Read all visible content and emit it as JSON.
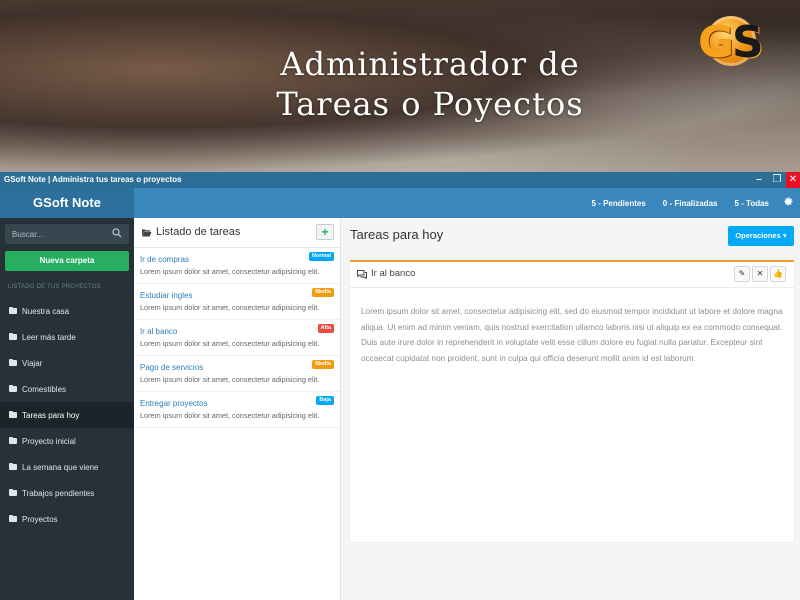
{
  "hero": {
    "title_line1": "Administrador de",
    "title_line2": "Tareas o Poyectos",
    "logo_letters": [
      "G",
      "S"
    ]
  },
  "window": {
    "title": "GSoft Note | Administra tus tareas o proyectos",
    "controls": [
      "minimize",
      "restore",
      "close"
    ],
    "control_glyphs": {
      "minimize": "–",
      "restore": "❐",
      "close": "✕"
    }
  },
  "topbar": {
    "brand": "GSoft Note",
    "counters": [
      "5 - Pendientes",
      "0 - Finalizadas",
      "5 - Todas"
    ],
    "settings_icon": "cogs-icon"
  },
  "sidebar": {
    "search_placeholder": "Buscar...",
    "new_folder_label": "Nueva carpeta",
    "heading": "LISTADO DE TUS PROYECTOS",
    "items": [
      {
        "label": "Nuestra casa",
        "active": false
      },
      {
        "label": "Leer más tarde",
        "active": false
      },
      {
        "label": "Viajar",
        "active": false
      },
      {
        "label": "Comestibles",
        "active": false
      },
      {
        "label": "Tareas para hoy",
        "active": true
      },
      {
        "label": "Proyecto inicial",
        "active": false
      },
      {
        "label": "La semana que viene",
        "active": false
      },
      {
        "label": "Trabajos pendientes",
        "active": false
      },
      {
        "label": "Proyectos",
        "active": false
      }
    ]
  },
  "task_list": {
    "title": "Listado de tareas",
    "add_label": "+",
    "tasks": [
      {
        "title": "Ir de compras",
        "desc": "Lorem ipsum dolor sit amet, consectetur adipisicing elit.",
        "badge": "Normal",
        "badge_color": "#03a9f4"
      },
      {
        "title": "Estudiar ingles",
        "desc": "Lorem ipsum dolor sit amet, consectetur adipisicing elit.",
        "badge": "Media",
        "badge_color": "#f39c12"
      },
      {
        "title": "Ir al banco",
        "desc": "Lorem ipsum dolor sit amet, consectetur adipisicing elit.",
        "badge": "Alta",
        "badge_color": "#e74c3c"
      },
      {
        "title": "Pago de servicios",
        "desc": "Lorem ipsum dolor sit amet, consectetur adipisicing elit.",
        "badge": "Media",
        "badge_color": "#f39c12"
      },
      {
        "title": "Entregar proyectos",
        "desc": "Lorem ipsum dolor sit amet, consectetur adipisicing elit.",
        "badge": "Baja",
        "badge_color": "#03a9f4"
      }
    ]
  },
  "main": {
    "title": "Tareas para hoy",
    "operations_label": "Operaciones ▾",
    "card": {
      "title": "Ir al banco",
      "actions": [
        "edit",
        "delete",
        "like"
      ],
      "action_glyphs": {
        "edit": "✎",
        "delete": "✕",
        "like": "👍"
      },
      "body": "Lorem ipsum dolor sit amet, consectetur adipisicing elit, sed do eiusmod tempor incididunt ut labore et dolore magna aliqua. Ut enim ad minim veniam, quis nostrud exercitation ullamco laboris nisi ut aliquip ex ea commodo consequat. Duis aute irure dolor in reprehenderit in voluptate velit esse cillum dolore eu fugiat nulla pariatur. Excepteur sint occaecat cupidatat non proident, sunt in culpa qui officia deserunt mollit anim id est laborum."
    }
  },
  "colors": {
    "accent": "#3a87bd",
    "titlebar": "#2c6e96",
    "sidebar": "#263238",
    "success": "#27ae60",
    "info": "#03a9f4",
    "warning": "#f39c12",
    "danger": "#e74c3c"
  }
}
